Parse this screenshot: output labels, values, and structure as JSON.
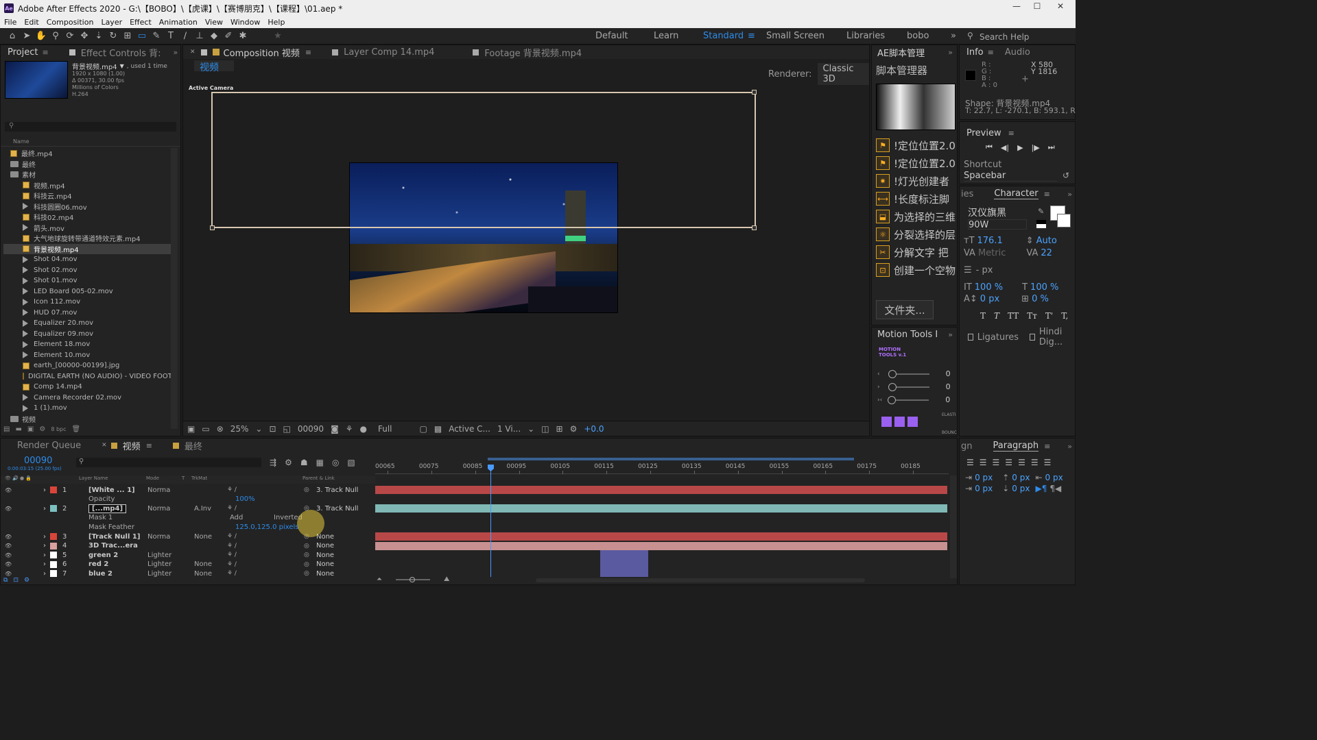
{
  "window": {
    "title": "Adobe After Effects 2020 - G:\\【BOBO】\\【虎课】\\【赛博朋克】\\【课程】\\01.aep *",
    "controls": [
      "—",
      "☐",
      "✕"
    ]
  },
  "menu": [
    "File",
    "Edit",
    "Composition",
    "Layer",
    "Effect",
    "Animation",
    "View",
    "Window",
    "Help"
  ],
  "workspaces": {
    "items": [
      "Default",
      "Learn",
      "Standard",
      "Small Screen",
      "Libraries",
      "bobo"
    ],
    "active": "Standard",
    "search": "Search Help"
  },
  "project": {
    "tab": "Project",
    "tab2": "Effect Controls 背:",
    "footage_name": "背景视频.mp4",
    "used": ", used 1 time",
    "info": [
      "1920 x 1080 (1.00)",
      "Δ 00371, 30.00 fps",
      "Millions of Colors",
      "H.264"
    ],
    "col_name": "Name",
    "bpc": "8 bpc",
    "items": [
      {
        "type": "comp",
        "name": "最终.mp4",
        "indent": 0
      },
      {
        "type": "folder",
        "name": "最终",
        "indent": 0
      },
      {
        "type": "folder",
        "name": "素材",
        "indent": 0
      },
      {
        "type": "comp",
        "name": "视频.mp4",
        "indent": 1
      },
      {
        "type": "comp",
        "name": "科技云.mp4",
        "indent": 1
      },
      {
        "type": "vid",
        "name": "科技圆圈06.mov",
        "indent": 1
      },
      {
        "type": "comp",
        "name": "科技02.mp4",
        "indent": 1
      },
      {
        "type": "vid",
        "name": "箭头.mov",
        "indent": 1
      },
      {
        "type": "comp",
        "name": "大气地球旋转带通道特效元素.mp4",
        "indent": 1
      },
      {
        "type": "comp",
        "name": "背景视频.mp4",
        "indent": 1,
        "selected": true
      },
      {
        "type": "vid",
        "name": "Shot 04.mov",
        "indent": 1
      },
      {
        "type": "vid",
        "name": "Shot 02.mov",
        "indent": 1
      },
      {
        "type": "vid",
        "name": "Shot 01.mov",
        "indent": 1
      },
      {
        "type": "vid",
        "name": "LED Board 005-02.mov",
        "indent": 1
      },
      {
        "type": "vid",
        "name": "Icon 112.mov",
        "indent": 1
      },
      {
        "type": "vid",
        "name": "HUD 07.mov",
        "indent": 1
      },
      {
        "type": "vid",
        "name": "Equalizer 20.mov",
        "indent": 1
      },
      {
        "type": "vid",
        "name": "Equalizer 09.mov",
        "indent": 1
      },
      {
        "type": "vid",
        "name": "Element 18.mov",
        "indent": 1
      },
      {
        "type": "vid",
        "name": "Element 10.mov",
        "indent": 1
      },
      {
        "type": "comp",
        "name": "earth_[00000-00199].jpg",
        "indent": 1
      },
      {
        "type": "comp",
        "name": "DIGITAL EARTH (NO AUDIO) - VIDEO FOOTA",
        "indent": 1
      },
      {
        "type": "comp",
        "name": "Comp 14.mp4",
        "indent": 1
      },
      {
        "type": "vid",
        "name": "Camera Recorder 02.mov",
        "indent": 1
      },
      {
        "type": "vid",
        "name": "1 (1).mov",
        "indent": 1
      },
      {
        "type": "folder",
        "name": "视频",
        "indent": 0
      }
    ]
  },
  "composition": {
    "tabs": [
      "Composition 视频",
      "Layer Comp 14.mp4",
      "Footage 背景视频.mp4"
    ],
    "subtab": "视频",
    "renderer_label": "Renderer:",
    "renderer": "Classic 3D",
    "active_camera": "Active Camera",
    "footer": {
      "zoom": "25%",
      "timecode": "00090",
      "resolution": "Full",
      "camera": "Active C...",
      "views": "1 Vi...",
      "exposure": "+0.0"
    }
  },
  "scripts": {
    "tab": "AE脚本管理",
    "title": "脚本管理器",
    "items": [
      "!定位位置2.0",
      "!定位位置2.0",
      "!灯光创建者",
      "!长度标注脚",
      "为选择的三维",
      "分裂选择的层",
      "分解文字 把",
      "创建一个空物"
    ],
    "folder_btn": "文件夹..."
  },
  "motion_tools": {
    "tab": "Motion Tools I",
    "logo": "MOTION TOOLS v.1",
    "values": [
      "0",
      "0",
      "0"
    ],
    "labels": [
      "ELASTI",
      "BOUNC"
    ]
  },
  "info": {
    "tab": "Info",
    "tab2": "Audio",
    "r": "R :",
    "g": "G :",
    "b": "B :",
    "a": "A : 0",
    "x": "X 580",
    "y": "Y 1816",
    "shape": "Shape: 背景视频.mp4",
    "shape2": "T: 22.7, L: -270.1, B: 593.1, R"
  },
  "preview": {
    "tab": "Preview",
    "shortcut_label": "Shortcut",
    "shortcut": "Spacebar"
  },
  "character": {
    "tab": "Character",
    "tab_left": "ies",
    "font": "汉仪旗黑",
    "weight": "90W",
    "size": "176.1",
    "leading": "Auto",
    "kerning": "Metric",
    "tracking": "22",
    "stroke": "- px",
    "vscale": "100 %",
    "hscale": "100 %",
    "baseline": "0 px",
    "tsume": "0 %",
    "styles": [
      "T",
      "T",
      "TT",
      "Tт",
      "T'",
      "T,"
    ],
    "ligatures": "Ligatures",
    "hindi": "Hindi Dig..."
  },
  "paragraph": {
    "tab": "Paragraph",
    "tab_left": "gn",
    "indents": [
      "0 px",
      "0 px",
      "0 px",
      "0 px",
      "0 px"
    ]
  },
  "timeline": {
    "tabs": [
      "Render Queue",
      "视频",
      "最终"
    ],
    "timecode": "00090",
    "timecode_sub": "0:00:03:15 (25.00 fps)",
    "columns": [
      "Layer Name",
      "Mode",
      "T",
      "TrkMat",
      "Parent & Link"
    ],
    "ruler": [
      "00065",
      "00075",
      "00085",
      "00095",
      "00105",
      "00115",
      "00125",
      "00135",
      "00145",
      "00155",
      "00165",
      "00175",
      "00185"
    ],
    "layers": [
      {
        "num": "1",
        "color": "#d9453a",
        "name": "[White ... 1]",
        "mode": "Norma",
        "trk": "",
        "parent": "3. Track Null",
        "bar": "#b84848"
      },
      {
        "num": "",
        "color": "",
        "name": "Opacity",
        "mode": "",
        "trk": "",
        "parent": "",
        "prop": "100%"
      },
      {
        "num": "2",
        "color": "#7dc0c0",
        "name": "[...mp4]",
        "mode": "Norma",
        "trk": "A.Inv",
        "parent": "3. Track Null",
        "bar": "#7fb8b4"
      },
      {
        "num": "",
        "color": "",
        "name": "Mask 1",
        "mode": "Add",
        "trk": "",
        "parent": "",
        "prop": "Inverted"
      },
      {
        "num": "",
        "color": "",
        "name": "Mask Feather",
        "mode": "",
        "trk": "",
        "parent": "",
        "prop": "125.0,125.0 pixels"
      },
      {
        "num": "3",
        "color": "#d9453a",
        "name": "[Track Null 1]",
        "mode": "Norma",
        "trk": "None",
        "parent": "None",
        "bar": "#b84848"
      },
      {
        "num": "4",
        "color": "#d9a0a0",
        "name": "3D Trac...era",
        "mode": "",
        "trk": "",
        "parent": "None",
        "bar": "#c89090"
      },
      {
        "num": "5",
        "color": "#ffffff",
        "name": "green 2",
        "mode": "Lighter",
        "trk": "",
        "parent": "None",
        "bar": "#5a5aa0"
      },
      {
        "num": "6",
        "color": "#ffffff",
        "name": "red 2",
        "mode": "Lighter",
        "trk": "None",
        "parent": "None",
        "bar": "#5a5aa0"
      },
      {
        "num": "7",
        "color": "#ffffff",
        "name": "blue 2",
        "mode": "Lighter",
        "trk": "None",
        "parent": "None",
        "bar": "#5a5aa0"
      }
    ]
  }
}
